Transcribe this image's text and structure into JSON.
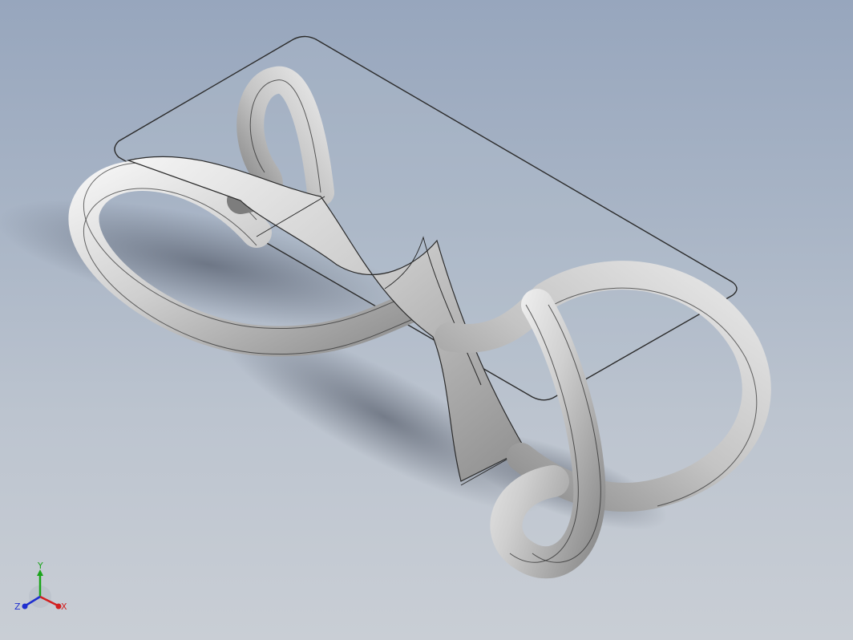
{
  "viewport": {
    "background_top": "#97a6bd",
    "background_bottom": "#c9ced5"
  },
  "model": {
    "body_color": "#cfcfcf",
    "edge_color": "#2b2b2b",
    "glass_color": "#b9c3cf"
  },
  "triad": {
    "x_label": "X",
    "y_label": "Y",
    "z_label": "Z",
    "x_color": "#d22020",
    "y_color": "#1aa41a",
    "z_color": "#1f2fcf"
  }
}
